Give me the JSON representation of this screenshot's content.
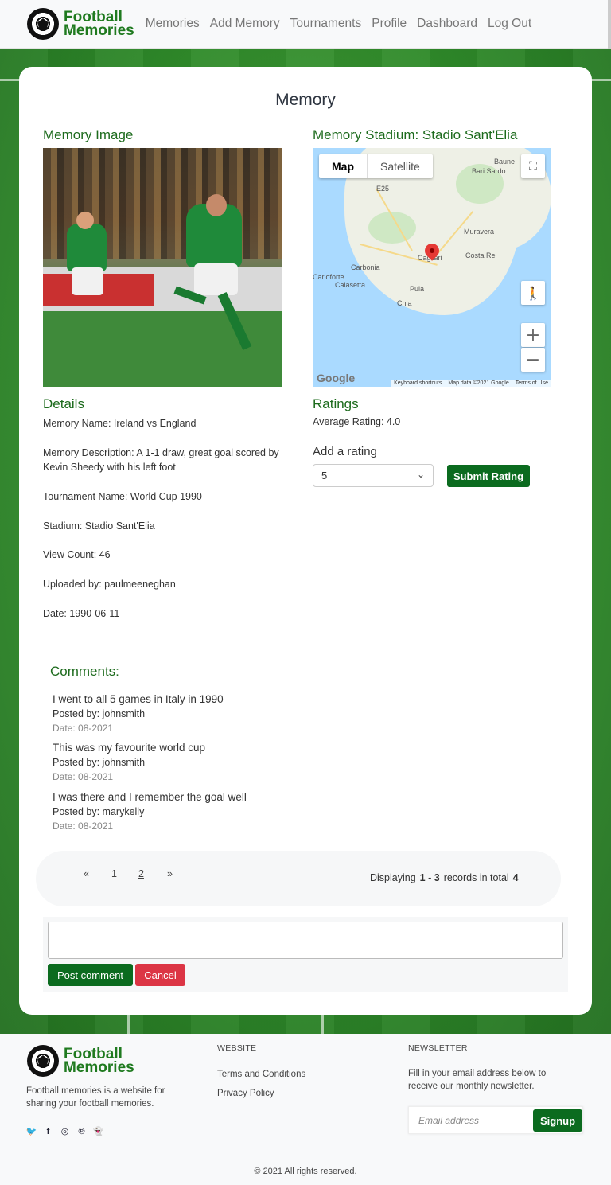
{
  "brand": {
    "line1": "Football",
    "line2": "Memories"
  },
  "nav": {
    "items": [
      "Memories",
      "Add Memory",
      "Tournaments",
      "Profile",
      "Dashboard",
      "Log Out"
    ]
  },
  "page": {
    "title": "Memory"
  },
  "image_section": {
    "heading": "Memory Image"
  },
  "map_section": {
    "heading": "Memory Stadium: Stadio Sant'Elia",
    "map_tab": "Map",
    "satellite_tab": "Satellite",
    "places": [
      "Bari Sardo",
      "Muravera",
      "Costa Rei",
      "Carbonia",
      "Calasetta",
      "Carloforte",
      "Pula",
      "Chia",
      "Cagliari",
      "Baune",
      "E25"
    ],
    "google": "Google",
    "attribution": [
      "Keyboard shortcuts",
      "Map data ©2021 Google",
      "Terms of Use"
    ]
  },
  "details": {
    "heading": "Details",
    "name": "Memory Name: Ireland vs England",
    "description": "Memory Description: A 1-1 draw, great goal scored by Kevin Sheedy with his left foot",
    "tournament": "Tournament Name: World Cup 1990",
    "stadium": "Stadium: Stadio Sant'Elia",
    "views": "View Count: 46",
    "uploader": "Uploaded by: paulmeeneghan",
    "date": "Date: 1990-06-11"
  },
  "ratings": {
    "heading": "Ratings",
    "average": "Average Rating: 4.0",
    "add_label": "Add a rating",
    "selected": "5",
    "submit": "Submit Rating"
  },
  "comments": {
    "heading": "Comments:",
    "items": [
      {
        "text": "I went to all 5 games in Italy in 1990",
        "posted": "Posted by: johnsmith",
        "date": "Date: 08-2021"
      },
      {
        "text": "This was my favourite world cup",
        "posted": "Posted by: johnsmith",
        "date": "Date: 08-2021"
      },
      {
        "text": "I was there and I remember the goal well",
        "posted": "Posted by: marykelly",
        "date": "Date: 08-2021"
      }
    ]
  },
  "pagination": {
    "prev": "«",
    "page1": "1",
    "page2": "2",
    "next": "»",
    "displaying": "Displaying",
    "range": "1 - 3",
    "records_in_total": "records in total",
    "total": "4"
  },
  "comment_form": {
    "post": "Post comment",
    "cancel": "Cancel"
  },
  "footer": {
    "description": "Football memories is a website for sharing your football memories.",
    "website_title": "WEBSITE",
    "terms": "Terms and Conditions",
    "privacy": "Privacy Policy",
    "newsletter_title": "NEWSLETTER",
    "newsletter_text": "Fill in your email address below to receive our monthly newsletter.",
    "email_placeholder": "Email address",
    "signup": "Signup",
    "copyright": "© 2021 All rights reserved.",
    "socials": [
      "twitter-icon",
      "facebook-icon",
      "instagram-icon",
      "pinterest-icon",
      "snapchat-icon"
    ]
  },
  "colors": {
    "brand_green": "#1f7a1f",
    "button_green": "#0b6b1f",
    "cancel_red": "#dc3545"
  }
}
